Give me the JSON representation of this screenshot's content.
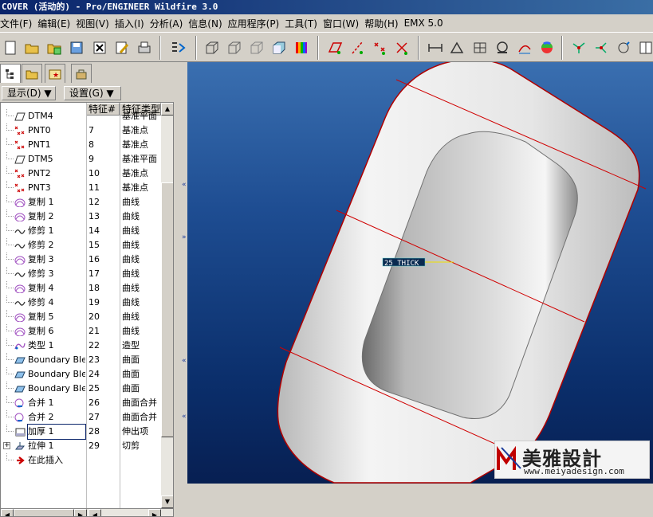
{
  "window": {
    "title": "COVER (活动的) - Pro/ENGINEER Wildfire 3.0"
  },
  "menu": [
    "文件(F)",
    "编辑(E)",
    "视图(V)",
    "插入(I)",
    "分析(A)",
    "信息(N)",
    "应用程序(P)",
    "工具(T)",
    "窗口(W)",
    "帮助(H)",
    "EMX 5.0"
  ],
  "panel": {
    "display_label": "显示(D) ▼",
    "settings_label": "设置(G) ▼",
    "col_num": "特征#",
    "col_type": "特征类型"
  },
  "tree_rows": [
    {
      "name": "DTM4",
      "num": "",
      "type": "基准平面",
      "icon": "plane"
    },
    {
      "name": "PNT0",
      "num": "7",
      "type": "基准点",
      "icon": "point"
    },
    {
      "name": "PNT1",
      "num": "8",
      "type": "基准点",
      "icon": "point"
    },
    {
      "name": "DTM5",
      "num": "9",
      "type": "基准平面",
      "icon": "plane"
    },
    {
      "name": "PNT2",
      "num": "10",
      "type": "基准点",
      "icon": "point"
    },
    {
      "name": "PNT3",
      "num": "11",
      "type": "基准点",
      "icon": "point"
    },
    {
      "name": "复制 1",
      "num": "12",
      "type": "曲线",
      "icon": "copy"
    },
    {
      "name": "复制 2",
      "num": "13",
      "type": "曲线",
      "icon": "copy"
    },
    {
      "name": "修剪 1",
      "num": "14",
      "type": "曲线",
      "icon": "trim"
    },
    {
      "name": "修剪 2",
      "num": "15",
      "type": "曲线",
      "icon": "trim"
    },
    {
      "name": "复制 3",
      "num": "16",
      "type": "曲线",
      "icon": "copy"
    },
    {
      "name": "修剪 3",
      "num": "17",
      "type": "曲线",
      "icon": "trim"
    },
    {
      "name": "复制 4",
      "num": "18",
      "type": "曲线",
      "icon": "copy"
    },
    {
      "name": "修剪 4",
      "num": "19",
      "type": "曲线",
      "icon": "trim"
    },
    {
      "name": "复制 5",
      "num": "20",
      "type": "曲线",
      "icon": "copy"
    },
    {
      "name": "复制 6",
      "num": "21",
      "type": "曲线",
      "icon": "copy"
    },
    {
      "name": "类型 1",
      "num": "22",
      "type": "造型",
      "icon": "style"
    },
    {
      "name": "Boundary Ble",
      "num": "23",
      "type": "曲面",
      "icon": "surface"
    },
    {
      "name": "Boundary Ble",
      "num": "24",
      "type": "曲面",
      "icon": "surface"
    },
    {
      "name": "Boundary Ble",
      "num": "25",
      "type": "曲面",
      "icon": "surface"
    },
    {
      "name": "合并 1",
      "num": "26",
      "type": "曲面合并",
      "icon": "merge"
    },
    {
      "name": "合并 2",
      "num": "27",
      "type": "曲面合并",
      "icon": "merge"
    },
    {
      "name": "加厚 1",
      "num": "28",
      "type": "伸出项",
      "icon": "thicken"
    },
    {
      "name": "拉伸 1",
      "num": "29",
      "type": "切剪",
      "icon": "extrude"
    },
    {
      "name": "在此插入",
      "num": "",
      "type": "",
      "icon": "insert"
    }
  ],
  "viewport": {
    "label": "25 THICK"
  },
  "watermark": {
    "brand": "美雅設計",
    "url": "www.meiyadesign.com"
  }
}
